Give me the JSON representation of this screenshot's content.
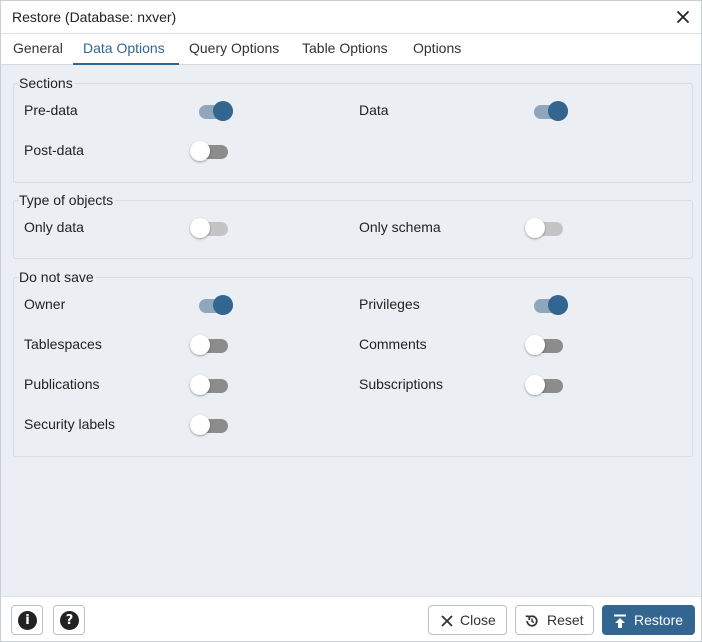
{
  "window": {
    "title": "Restore (Database: nxver)"
  },
  "tabs": [
    {
      "label": "General"
    },
    {
      "label": "Data Options"
    },
    {
      "label": "Query Options"
    },
    {
      "label": "Table Options"
    },
    {
      "label": "Options"
    }
  ],
  "active_tab": "Data Options",
  "sections": {
    "sections": {
      "legend": "Sections",
      "options": [
        {
          "label": "Pre-data",
          "on": true
        },
        {
          "label": "Data",
          "on": true
        },
        {
          "label": "Post-data",
          "on": false
        }
      ]
    },
    "type_of_objects": {
      "legend": "Type of objects",
      "options": [
        {
          "label": "Only data",
          "on": false
        },
        {
          "label": "Only schema",
          "on": false
        }
      ]
    },
    "do_not_save": {
      "legend": "Do not save",
      "options": [
        {
          "label": "Owner",
          "on": true
        },
        {
          "label": "Privileges",
          "on": true
        },
        {
          "label": "Tablespaces",
          "on": false
        },
        {
          "label": "Comments",
          "on": false
        },
        {
          "label": "Publications",
          "on": false
        },
        {
          "label": "Subscriptions",
          "on": false
        },
        {
          "label": "Security labels",
          "on": false
        }
      ]
    }
  },
  "footer": {
    "info_icon": "info-icon",
    "help_icon": "help-icon",
    "close_label": "Close",
    "reset_label": "Reset",
    "restore_label": "Restore"
  },
  "colors": {
    "accent": "#326690",
    "switch_on_track": "#8fa6bd",
    "switch_off_track": "#8c8c8c",
    "background": "#ebeef3"
  }
}
